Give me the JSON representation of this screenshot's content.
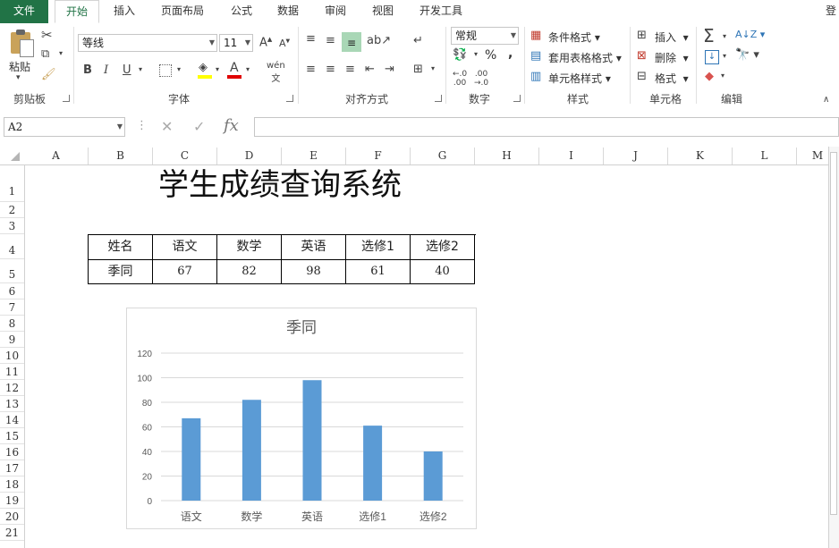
{
  "ribbon_tabs": [
    "文件",
    "开始",
    "插入",
    "页面布局",
    "公式",
    "数据",
    "审阅",
    "视图",
    "开发工具"
  ],
  "account_label": "登",
  "clipboard": {
    "paste_label": "粘贴",
    "group_label": "剪贴板"
  },
  "font": {
    "name": "等线",
    "size": "11",
    "group_label": "字体"
  },
  "alignment": {
    "group_label": "对齐方式"
  },
  "number": {
    "format": "常规",
    "group_label": "数字",
    "percent": "%",
    "comma": ","
  },
  "styles": {
    "conditional": "条件格式",
    "table_format": "套用表格格式",
    "cell_styles": "单元格样式",
    "group_label": "样式"
  },
  "cells": {
    "insert": "插入",
    "delete": "删除",
    "format": "格式",
    "group_label": "单元格"
  },
  "editing": {
    "group_label": "编辑"
  },
  "formula_bar": {
    "name_box": "A2",
    "fx": "fx",
    "content": ""
  },
  "columns": [
    "A",
    "B",
    "C",
    "D",
    "E",
    "F",
    "G",
    "H",
    "I",
    "J",
    "K",
    "L",
    "M"
  ],
  "rows": [
    "1",
    "2",
    "3",
    "4",
    "5",
    "6",
    "7",
    "8",
    "9",
    "10",
    "11",
    "12",
    "13",
    "14",
    "15",
    "16",
    "17",
    "18",
    "19",
    "20",
    "21"
  ],
  "sheet": {
    "title": "学生成绩查询系统",
    "table_headers": [
      "姓名",
      "语文",
      "数学",
      "英语",
      "选修1",
      "选修2"
    ],
    "table_row": [
      "季同",
      "67",
      "82",
      "98",
      "61",
      "40"
    ]
  },
  "chart_data": {
    "type": "bar",
    "title": "季同",
    "categories": [
      "语文",
      "数学",
      "英语",
      "选修1",
      "选修2"
    ],
    "values": [
      67,
      82,
      98,
      61,
      40
    ],
    "ylim": [
      0,
      120
    ],
    "yticks": [
      "0",
      "20",
      "40",
      "60",
      "80",
      "100",
      "120"
    ],
    "grid": true,
    "bar_color": "#5b9bd5"
  },
  "colors": {
    "file_tab": "#217346",
    "accent": "#217346"
  }
}
